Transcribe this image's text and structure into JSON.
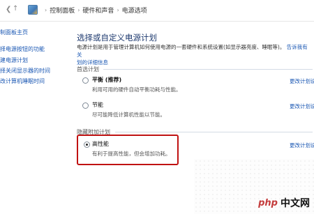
{
  "address_bar": {
    "crumbs": [
      "控制面板",
      "硬件和声音",
      "电源选项"
    ]
  },
  "sidebar": {
    "items": [
      {
        "label": "制面板主页"
      },
      {
        "label": "择电源按钮的功能"
      },
      {
        "label": "建电源计划"
      },
      {
        "label": "择关闭显示器的时间"
      },
      {
        "label": "改计算机睡眠时间"
      }
    ]
  },
  "main": {
    "title": "选择或自定义电源计划",
    "description": "电源计划是用于管理计算机如何使用电源的一套硬件和系统设置(如显示器亮度、睡眠等)。",
    "description_link": "告诉我有关",
    "description_link2": "划的详细信息",
    "preferred_section": "首选计划",
    "hidden_section": "隐藏附加计划",
    "plans": [
      {
        "name": "平衡 (推荐)",
        "desc": "利用可用的硬件自动平衡功耗与性能。",
        "change": "更改计划设置",
        "selected": false
      },
      {
        "name": "节能",
        "desc": "尽可能降低计算机性能以节能。",
        "change": "更改计划设置",
        "selected": false
      },
      {
        "name": "高性能",
        "desc": "有利于提高性能，但会增加功耗。",
        "change": "更改计划设",
        "selected": true
      }
    ]
  },
  "watermark": {
    "brand": "php",
    "text": "中文网"
  },
  "colors": {
    "link": "#1a57b3",
    "highlight": "#c01212",
    "title": "#1e3a6f"
  },
  "icons": [
    "back-arrow-icon",
    "forward-arrow-icon",
    "up-arrow-icon",
    "control-panel-icon"
  ]
}
